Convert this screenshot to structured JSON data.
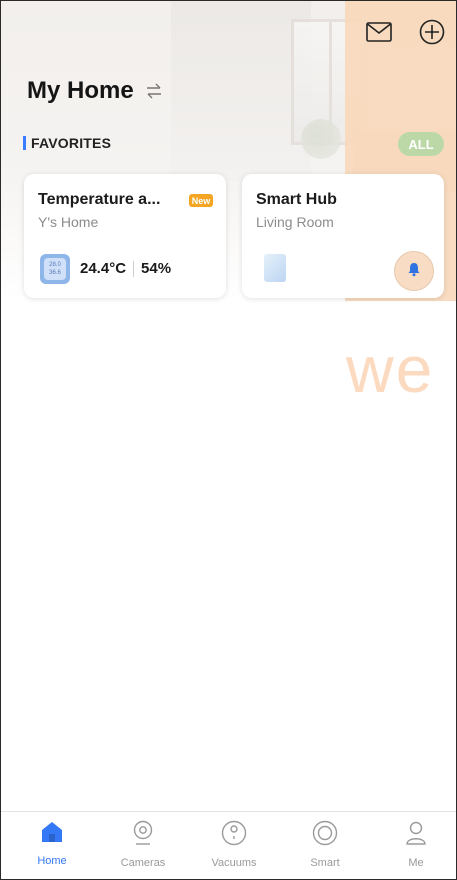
{
  "header": {
    "title": "My Home",
    "icons": [
      "mail-icon",
      "add-circle-icon",
      "switch-arrows-icon"
    ]
  },
  "favorites": {
    "label": "FAVORITES",
    "all_label": "ALL"
  },
  "cards": [
    {
      "name": "Temperature a...",
      "badge": "New",
      "location": "Y's Home",
      "temperature": "24.4°C",
      "humidity": "54%",
      "icon": "thermo-hygrometer-icon"
    },
    {
      "name": "Smart Hub",
      "location": "Living Room",
      "icon": "hub-device-icon",
      "action_icon": "bell-icon"
    }
  ],
  "watermark": "we",
  "tabbar": {
    "items": [
      {
        "label": "Home",
        "icon": "home-icon",
        "active": true
      },
      {
        "label": "Cameras",
        "icon": "camera-icon",
        "active": false
      },
      {
        "label": "Vacuums",
        "icon": "vacuum-icon",
        "active": false
      },
      {
        "label": "Smart",
        "icon": "smart-icon",
        "active": false
      },
      {
        "label": "Me",
        "icon": "person-icon",
        "active": false
      }
    ]
  },
  "colors": {
    "accent": "#3478f6",
    "badge": "#f4a623",
    "overlay": "#f8d9bd",
    "all_button": "#bcd8a7"
  }
}
